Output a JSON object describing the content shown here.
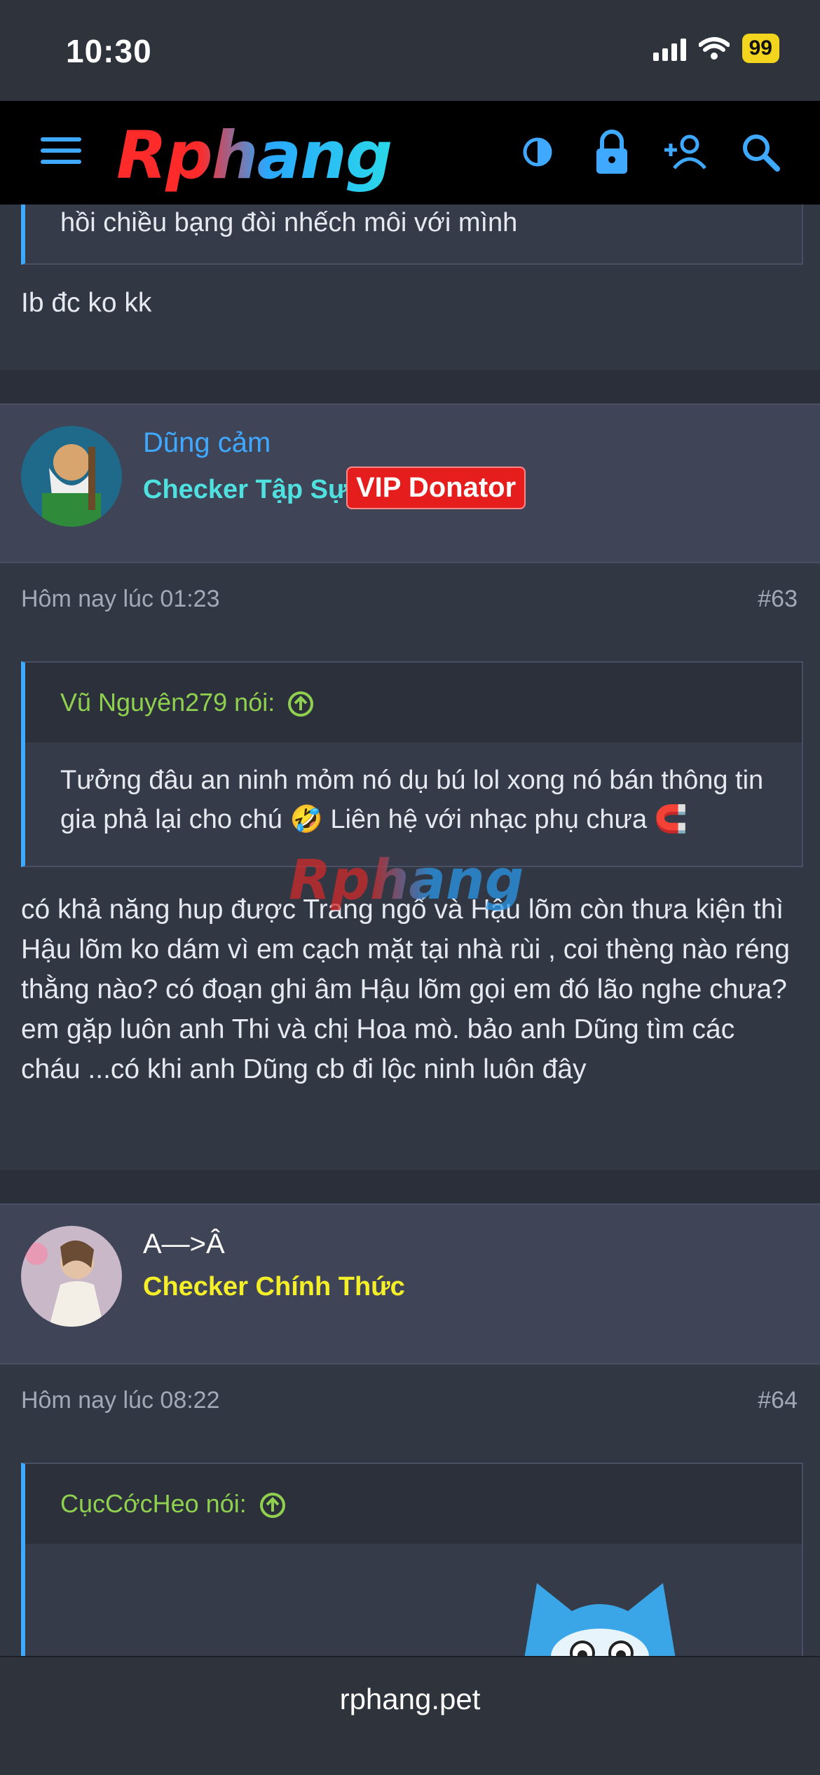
{
  "status": {
    "time": "10:30",
    "battery": "99"
  },
  "nav": {
    "logo": "Rphang"
  },
  "post_top": {
    "quote_line": "hồi chiều bạng đòi nhếch môi với mình",
    "text": "Ib đc ko kk"
  },
  "post63": {
    "username": "Dũng cảm",
    "title": "Checker Tập Sự",
    "badge": "VIP Donator",
    "time": "Hôm nay lúc 01:23",
    "number": "#63",
    "quote_author": "Vũ Nguyên279 nói:",
    "quote_text": "Tưởng đâu an ninh mỏm nó dụ bú lol xong nó bán thông tin gia phả lại cho chú 🤣 Liên hệ với nhạc phụ chưa 🧲",
    "text": "có khả năng hup được Trang ngố và Hậu lõm còn thưa kiện thì Hậu lõm ko dám vì em cạch mặt tại nhà rùi , coi thèng nào réng thằng nào? có đoạn ghi âm Hậu lõm gọi em đó lão nghe chưa? em gặp luôn anh Thi và chị Hoa mò. bảo anh Dũng tìm các cháu ...có khi anh Dũng cb đi lộc ninh luôn đây"
  },
  "post64": {
    "username": "A—>Â",
    "title": "Checker Chính Thức",
    "time": "Hôm nay lúc 08:22",
    "number": "#64",
    "quote_author": "CụcCớcHeo nói:"
  },
  "watermark": "Rphang",
  "bottom": {
    "url": "rphang.pet"
  },
  "colors": {
    "accent": "#3fa9ff",
    "quote_author": "#8fd14f",
    "title_cyan": "#4fe0e0",
    "title_yellow": "#f5ef2a",
    "badge_red": "#e51d1d"
  }
}
